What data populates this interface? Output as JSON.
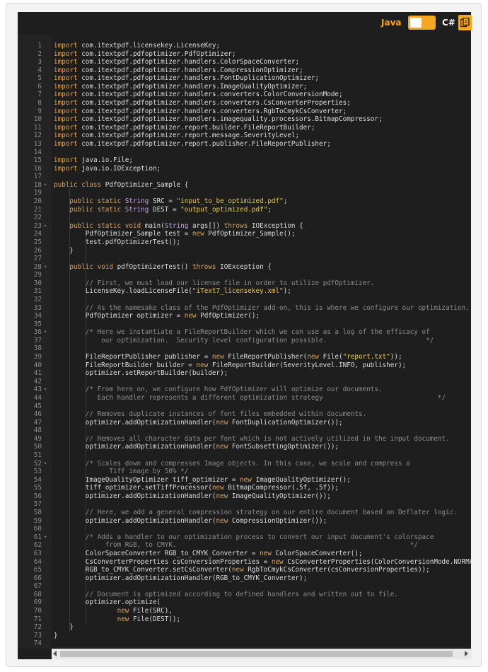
{
  "header": {
    "lang_java": "Java",
    "lang_csharp": "C#",
    "toggle_icon": "toggle-switch-icon",
    "copy_icon": "copy-icon",
    "accent": "#f5a623"
  },
  "editor": {
    "lines": [
      {
        "n": "1",
        "t": "import com.itextpdf.licensekey.LicenseKey;"
      },
      {
        "n": "2",
        "t": "import com.itextpdf.pdfoptimizer.PdfOptimizer;"
      },
      {
        "n": "3",
        "t": "import com.itextpdf.pdfoptimizer.handlers.ColorSpaceConverter;"
      },
      {
        "n": "4",
        "t": "import com.itextpdf.pdfoptimizer.handlers.CompressionOptimizer;"
      },
      {
        "n": "5",
        "t": "import com.itextpdf.pdfoptimizer.handlers.FontDuplicationOptimizer;"
      },
      {
        "n": "6",
        "t": "import com.itextpdf.pdfoptimizer.handlers.ImageQualityOptimizer;"
      },
      {
        "n": "7",
        "t": "import com.itextpdf.pdfoptimizer.handlers.converters.ColorConversionMode;"
      },
      {
        "n": "8",
        "t": "import com.itextpdf.pdfoptimizer.handlers.converters.CsConverterProperties;"
      },
      {
        "n": "9",
        "t": "import com.itextpdf.pdfoptimizer.handlers.converters.RgbToCmykCsConverter;"
      },
      {
        "n": "10",
        "t": "import com.itextpdf.pdfoptimizer.handlers.imagequality.processors.BitmapCompressor;"
      },
      {
        "n": "11",
        "t": "import com.itextpdf.pdfoptimizer.report.builder.FileReportBuilder;"
      },
      {
        "n": "12",
        "t": "import com.itextpdf.pdfoptimizer.report.message.SeverityLevel;"
      },
      {
        "n": "13",
        "t": "import com.itextpdf.pdfoptimizer.report.publisher.FileReportPublisher;"
      },
      {
        "n": "14",
        "t": ""
      },
      {
        "n": "15",
        "t": "import java.io.File;"
      },
      {
        "n": "16",
        "t": "import java.io.IOException;"
      },
      {
        "n": "17",
        "t": ""
      },
      {
        "n": "18",
        "t": "public class PdfOptimizer_Sample {",
        "fold": true
      },
      {
        "n": "19",
        "t": ""
      },
      {
        "n": "20",
        "t": "    public static String SRC = \"input_to_be_optimized.pdf\";"
      },
      {
        "n": "21",
        "t": "    public static String DEST = \"output_optimized.pdf\";"
      },
      {
        "n": "22",
        "t": ""
      },
      {
        "n": "23",
        "t": "    public static void main(String args[]) throws IOException {",
        "fold": true
      },
      {
        "n": "24",
        "t": "        PdfOptimizer_Sample test = new PdfOptimizer_Sample();"
      },
      {
        "n": "25",
        "t": "        test.pdfOptimizerTest();"
      },
      {
        "n": "26",
        "t": "    }"
      },
      {
        "n": "27",
        "t": ""
      },
      {
        "n": "28",
        "t": "    public void pdfOptimizerTest() throws IOException {",
        "fold": true
      },
      {
        "n": "29",
        "t": ""
      },
      {
        "n": "30",
        "t": "        // First, we must load our license file in order to utilize pdfOptimizer."
      },
      {
        "n": "31",
        "t": "        LicenseKey.loadLicenseFile(\"iText7_licensekey.xml\");"
      },
      {
        "n": "32",
        "t": ""
      },
      {
        "n": "33",
        "t": "        // As the namesake class of the PdfOptimizer add-on, this is where we configure our optimization."
      },
      {
        "n": "34",
        "t": "        PdfOptimizer optimizer = new PdfOptimizer();"
      },
      {
        "n": "35",
        "t": ""
      },
      {
        "n": "36",
        "t": "        /* Here we instantiate a FileReportBuilder which we can use as a log of the efficacy of",
        "fold": true
      },
      {
        "n": "37",
        "t": "            our optimization.  Security level configuration possible.                         */"
      },
      {
        "n": "38",
        "t": ""
      },
      {
        "n": "39",
        "t": "        FileReportPublisher publisher = new FileReportPublisher(new File(\"report.txt\"));"
      },
      {
        "n": "40",
        "t": "        FileReportBuilder builder = new FileReportBuilder(SeverityLevel.INFO, publisher);"
      },
      {
        "n": "41",
        "t": "        optimizer.setReportBuilder(builder);"
      },
      {
        "n": "42",
        "t": ""
      },
      {
        "n": "43",
        "t": "        /* From here on, we configure how PdfOptimizer will optimize our documents.",
        "fold": true
      },
      {
        "n": "44",
        "t": "           Each handler represents a different optimization strategy                             */"
      },
      {
        "n": "45",
        "t": ""
      },
      {
        "n": "46",
        "t": "        // Removes duplicate instances of font files embedded within documents."
      },
      {
        "n": "47",
        "t": "        optimizer.addOptimizationHandler(new FontDuplicationOptimizer());"
      },
      {
        "n": "48",
        "t": ""
      },
      {
        "n": "49",
        "t": "        // Removes all character data per font which is not actively utilized in the input document."
      },
      {
        "n": "50",
        "t": "        optimizer.addOptimizationHandler(new FontSubsettingOptimizer());"
      },
      {
        "n": "51",
        "t": ""
      },
      {
        "n": "52",
        "t": "        /* Scales down and compresses Image objects. In this case, we scale and compress a",
        "fold": true
      },
      {
        "n": "53",
        "t": "              Tiff image by 50% */"
      },
      {
        "n": "54",
        "t": "        ImageQualityOptimizer tiff_optimizer = new ImageQualityOptimizer();"
      },
      {
        "n": "55",
        "t": "        tiff_optimizer.setTiffProcessor(new BitmapCompressor(.5f, .5f));"
      },
      {
        "n": "56",
        "t": "        optimizer.addOptimizationHandler(new ImageQualityOptimizer());"
      },
      {
        "n": "57",
        "t": ""
      },
      {
        "n": "58",
        "t": "        // Here, we add a general compression strategy on our entire document based on Deflater logic."
      },
      {
        "n": "59",
        "t": "        optimizer.addOptimizationHandler(new CompressionOptimizer());"
      },
      {
        "n": "60",
        "t": ""
      },
      {
        "n": "61",
        "t": "        /* Adds a handler to our optimization process to convert our input document's colorspace",
        "fold": true
      },
      {
        "n": "62",
        "t": "             from RGB, to CMYK.                                                           */"
      },
      {
        "n": "63",
        "t": "        ColorSpaceConverter RGB_to_CMYK_Converter = new ColorSpaceConverter();"
      },
      {
        "n": "64",
        "t": "        CsConverterProperties csConversionProperties = new CsConverterProperties(ColorConversionMode.NORMAL);"
      },
      {
        "n": "65",
        "t": "        RGB_to_CMYK_Converter.setCsConverter(new RgbToCmykCsConverter(csConversionProperties));"
      },
      {
        "n": "66",
        "t": "        optimizer.addOptimizationHandler(RGB_to_CMYK_Converter);"
      },
      {
        "n": "67",
        "t": ""
      },
      {
        "n": "68",
        "t": "        // Document is optimized according to defined handlers and written out to file."
      },
      {
        "n": "69",
        "t": "        optimizer.optimize("
      },
      {
        "n": "70",
        "t": "                new File(SRC),"
      },
      {
        "n": "71",
        "t": "                new File(DEST));"
      },
      {
        "n": "72",
        "t": "    }"
      },
      {
        "n": "73",
        "t": "}"
      },
      {
        "n": "74",
        "t": ""
      }
    ]
  },
  "scrollbar": {
    "left_icon": "scroll-left-arrow-icon",
    "right_icon": "scroll-right-arrow-icon"
  }
}
